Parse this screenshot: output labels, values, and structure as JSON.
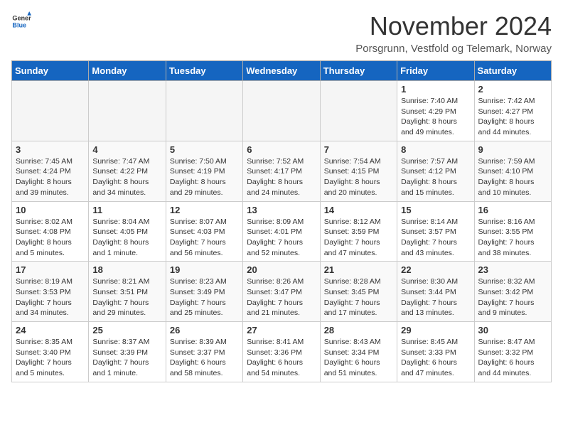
{
  "header": {
    "logo": {
      "line1": "General",
      "line2": "Blue"
    },
    "title": "November 2024",
    "subtitle": "Porsgrunn, Vestfold og Telemark, Norway"
  },
  "days_of_week": [
    "Sunday",
    "Monday",
    "Tuesday",
    "Wednesday",
    "Thursday",
    "Friday",
    "Saturday"
  ],
  "weeks": [
    [
      {
        "day": "",
        "empty": true
      },
      {
        "day": "",
        "empty": true
      },
      {
        "day": "",
        "empty": true
      },
      {
        "day": "",
        "empty": true
      },
      {
        "day": "",
        "empty": true
      },
      {
        "day": "1",
        "sunrise": "Sunrise: 7:40 AM",
        "sunset": "Sunset: 4:29 PM",
        "daylight": "Daylight: 8 hours and 49 minutes."
      },
      {
        "day": "2",
        "sunrise": "Sunrise: 7:42 AM",
        "sunset": "Sunset: 4:27 PM",
        "daylight": "Daylight: 8 hours and 44 minutes."
      }
    ],
    [
      {
        "day": "3",
        "sunrise": "Sunrise: 7:45 AM",
        "sunset": "Sunset: 4:24 PM",
        "daylight": "Daylight: 8 hours and 39 minutes."
      },
      {
        "day": "4",
        "sunrise": "Sunrise: 7:47 AM",
        "sunset": "Sunset: 4:22 PM",
        "daylight": "Daylight: 8 hours and 34 minutes."
      },
      {
        "day": "5",
        "sunrise": "Sunrise: 7:50 AM",
        "sunset": "Sunset: 4:19 PM",
        "daylight": "Daylight: 8 hours and 29 minutes."
      },
      {
        "day": "6",
        "sunrise": "Sunrise: 7:52 AM",
        "sunset": "Sunset: 4:17 PM",
        "daylight": "Daylight: 8 hours and 24 minutes."
      },
      {
        "day": "7",
        "sunrise": "Sunrise: 7:54 AM",
        "sunset": "Sunset: 4:15 PM",
        "daylight": "Daylight: 8 hours and 20 minutes."
      },
      {
        "day": "8",
        "sunrise": "Sunrise: 7:57 AM",
        "sunset": "Sunset: 4:12 PM",
        "daylight": "Daylight: 8 hours and 15 minutes."
      },
      {
        "day": "9",
        "sunrise": "Sunrise: 7:59 AM",
        "sunset": "Sunset: 4:10 PM",
        "daylight": "Daylight: 8 hours and 10 minutes."
      }
    ],
    [
      {
        "day": "10",
        "sunrise": "Sunrise: 8:02 AM",
        "sunset": "Sunset: 4:08 PM",
        "daylight": "Daylight: 8 hours and 5 minutes."
      },
      {
        "day": "11",
        "sunrise": "Sunrise: 8:04 AM",
        "sunset": "Sunset: 4:05 PM",
        "daylight": "Daylight: 8 hours and 1 minute."
      },
      {
        "day": "12",
        "sunrise": "Sunrise: 8:07 AM",
        "sunset": "Sunset: 4:03 PM",
        "daylight": "Daylight: 7 hours and 56 minutes."
      },
      {
        "day": "13",
        "sunrise": "Sunrise: 8:09 AM",
        "sunset": "Sunset: 4:01 PM",
        "daylight": "Daylight: 7 hours and 52 minutes."
      },
      {
        "day": "14",
        "sunrise": "Sunrise: 8:12 AM",
        "sunset": "Sunset: 3:59 PM",
        "daylight": "Daylight: 7 hours and 47 minutes."
      },
      {
        "day": "15",
        "sunrise": "Sunrise: 8:14 AM",
        "sunset": "Sunset: 3:57 PM",
        "daylight": "Daylight: 7 hours and 43 minutes."
      },
      {
        "day": "16",
        "sunrise": "Sunrise: 8:16 AM",
        "sunset": "Sunset: 3:55 PM",
        "daylight": "Daylight: 7 hours and 38 minutes."
      }
    ],
    [
      {
        "day": "17",
        "sunrise": "Sunrise: 8:19 AM",
        "sunset": "Sunset: 3:53 PM",
        "daylight": "Daylight: 7 hours and 34 minutes."
      },
      {
        "day": "18",
        "sunrise": "Sunrise: 8:21 AM",
        "sunset": "Sunset: 3:51 PM",
        "daylight": "Daylight: 7 hours and 29 minutes."
      },
      {
        "day": "19",
        "sunrise": "Sunrise: 8:23 AM",
        "sunset": "Sunset: 3:49 PM",
        "daylight": "Daylight: 7 hours and 25 minutes."
      },
      {
        "day": "20",
        "sunrise": "Sunrise: 8:26 AM",
        "sunset": "Sunset: 3:47 PM",
        "daylight": "Daylight: 7 hours and 21 minutes."
      },
      {
        "day": "21",
        "sunrise": "Sunrise: 8:28 AM",
        "sunset": "Sunset: 3:45 PM",
        "daylight": "Daylight: 7 hours and 17 minutes."
      },
      {
        "day": "22",
        "sunrise": "Sunrise: 8:30 AM",
        "sunset": "Sunset: 3:44 PM",
        "daylight": "Daylight: 7 hours and 13 minutes."
      },
      {
        "day": "23",
        "sunrise": "Sunrise: 8:32 AM",
        "sunset": "Sunset: 3:42 PM",
        "daylight": "Daylight: 7 hours and 9 minutes."
      }
    ],
    [
      {
        "day": "24",
        "sunrise": "Sunrise: 8:35 AM",
        "sunset": "Sunset: 3:40 PM",
        "daylight": "Daylight: 7 hours and 5 minutes."
      },
      {
        "day": "25",
        "sunrise": "Sunrise: 8:37 AM",
        "sunset": "Sunset: 3:39 PM",
        "daylight": "Daylight: 7 hours and 1 minute."
      },
      {
        "day": "26",
        "sunrise": "Sunrise: 8:39 AM",
        "sunset": "Sunset: 3:37 PM",
        "daylight": "Daylight: 6 hours and 58 minutes."
      },
      {
        "day": "27",
        "sunrise": "Sunrise: 8:41 AM",
        "sunset": "Sunset: 3:36 PM",
        "daylight": "Daylight: 6 hours and 54 minutes."
      },
      {
        "day": "28",
        "sunrise": "Sunrise: 8:43 AM",
        "sunset": "Sunset: 3:34 PM",
        "daylight": "Daylight: 6 hours and 51 minutes."
      },
      {
        "day": "29",
        "sunrise": "Sunrise: 8:45 AM",
        "sunset": "Sunset: 3:33 PM",
        "daylight": "Daylight: 6 hours and 47 minutes."
      },
      {
        "day": "30",
        "sunrise": "Sunrise: 8:47 AM",
        "sunset": "Sunset: 3:32 PM",
        "daylight": "Daylight: 6 hours and 44 minutes."
      }
    ]
  ]
}
